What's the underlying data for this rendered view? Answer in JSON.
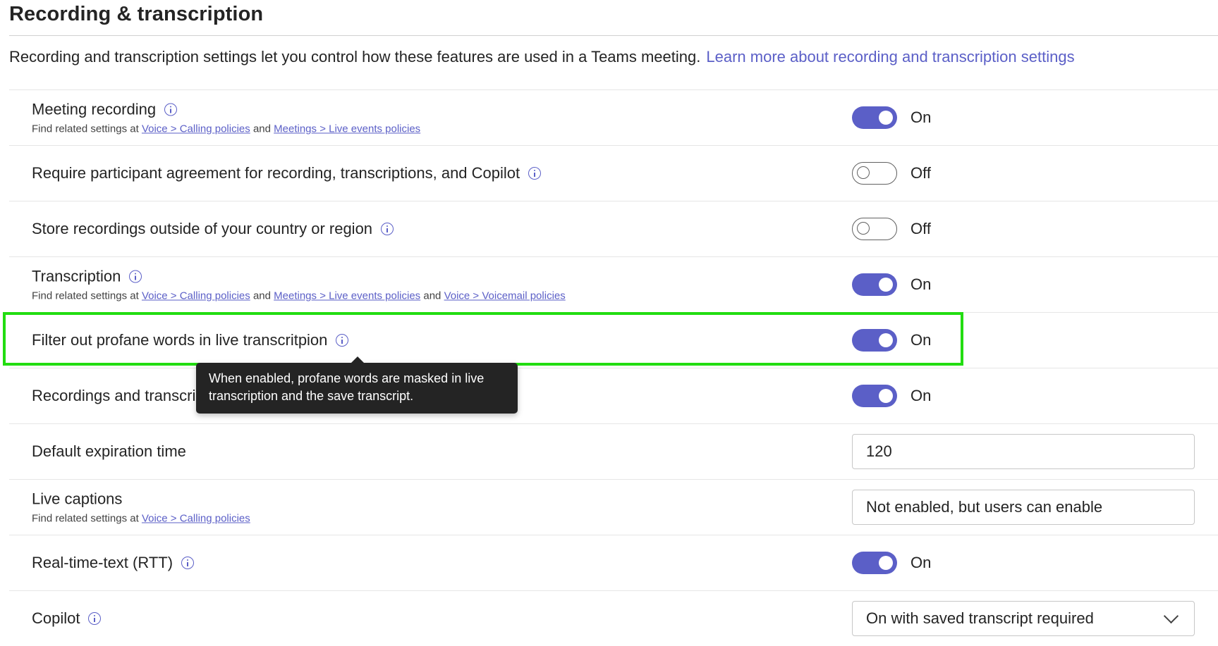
{
  "page": {
    "title": "Recording & transcription",
    "intro": "Recording and transcription settings let you control how these features are used in a Teams meeting.",
    "learn_more": "Learn more about recording and transcription settings"
  },
  "common": {
    "find_related": "Find related settings at",
    "and": "and",
    "voice_calling": "Voice > Calling policies",
    "meetings_live": "Meetings > Live events policies",
    "voice_voicemail": "Voice > Voicemail policies"
  },
  "settings": [
    {
      "label": "Meeting recording",
      "state": "On"
    },
    {
      "label": "Require participant agreement for recording, transcriptions, and Copilot",
      "state": "Off"
    },
    {
      "label": "Store recordings outside of your country or region",
      "state": "Off"
    },
    {
      "label": "Transcription",
      "state": "On"
    },
    {
      "label": "Filter out profane words in live transcritpion",
      "state": "On"
    },
    {
      "label": "Recordings and transcri",
      "state": "On"
    },
    {
      "label": "Default expiration time",
      "value": "120"
    },
    {
      "label": "Live captions",
      "value": "Not enabled, but users can enable"
    },
    {
      "label": "Real-time-text (RTT)",
      "state": "On"
    },
    {
      "label": "Copilot",
      "value": "On with saved transcript required"
    }
  ],
  "tooltip": {
    "text": "When enabled, profane words are masked in live transcription and the save transcript."
  },
  "colors": {
    "accent": "#5b5fc7",
    "highlight": "#22dd11",
    "tooltip_bg": "#242424"
  }
}
